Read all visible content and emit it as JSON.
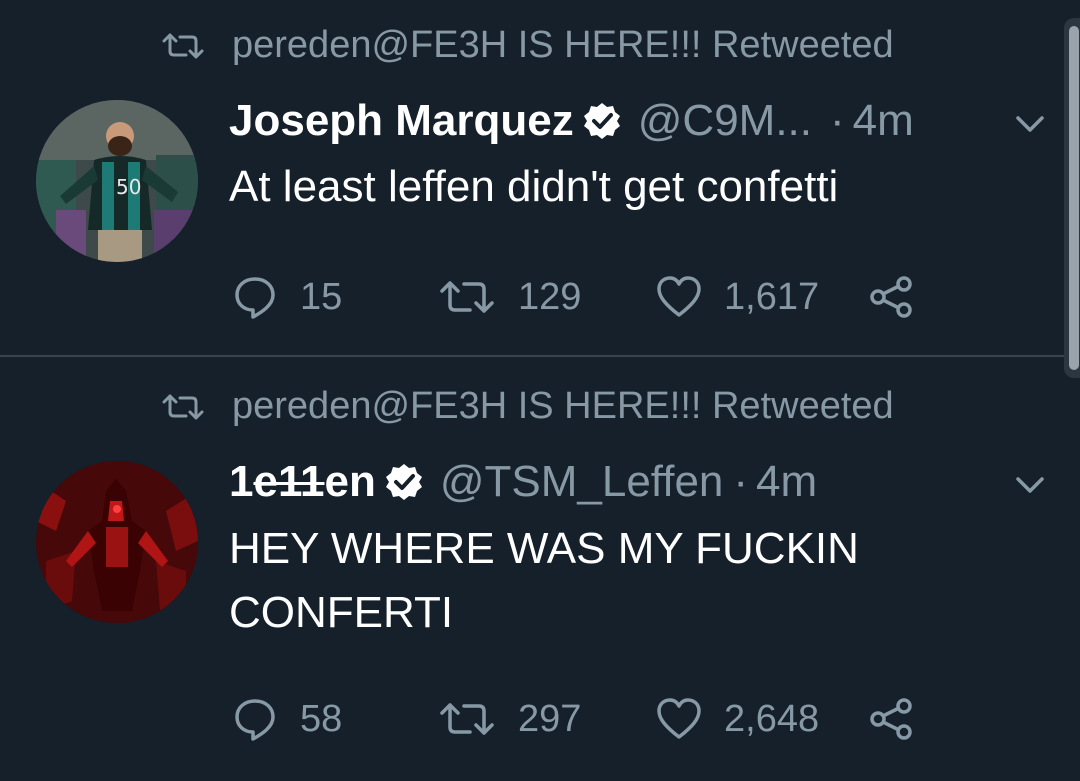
{
  "retweet_banner": "pereden@FE3H IS HERE!!! Retweeted",
  "tweets": [
    {
      "retweeted_by": "pereden@FE3H IS HERE!!! Retweeted",
      "display_name": "Joseph Marquez",
      "handle": "@C9M...",
      "separator": "·",
      "time": "4m",
      "text": "At least leffen didn't get confetti",
      "replies": "15",
      "retweets": "129",
      "likes": "1,617",
      "avatar": "man-in-eagles-jersey-avatar"
    },
    {
      "retweeted_by": "pereden@FE3H IS HERE!!! Retweeted",
      "display_name_prefix": "1",
      "display_name_struck": "e11",
      "display_name_suffix": "en",
      "handle": "@TSM_Leffen",
      "separator": "·",
      "time": "4m",
      "text_line1": "HEY WHERE WAS MY FUCKIN",
      "text_line2": "CONFERTI",
      "replies": "58",
      "retweets": "297",
      "likes": "2,648",
      "avatar": "red-mecha-avatar"
    }
  ],
  "icons": {
    "retweet": "retweet-icon",
    "verified": "verified-badge-icon",
    "chevron": "chevron-down-icon",
    "reply": "reply-icon",
    "like": "heart-icon",
    "share": "share-icon"
  },
  "colors": {
    "background": "#15202b",
    "muted": "#8899a6",
    "divider": "#38444d",
    "text": "#ffffff"
  }
}
